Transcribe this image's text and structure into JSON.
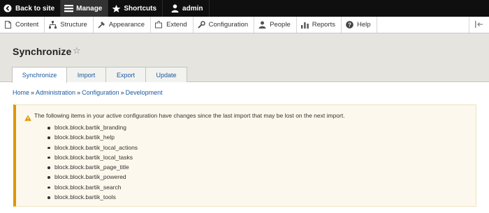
{
  "toolbar": {
    "back_label": "Back to site",
    "manage_label": "Manage",
    "shortcuts_label": "Shortcuts",
    "user_label": "admin"
  },
  "admin_menu": {
    "items": [
      {
        "label": "Content",
        "icon": "content-icon"
      },
      {
        "label": "Structure",
        "icon": "structure-icon"
      },
      {
        "label": "Appearance",
        "icon": "appearance-icon"
      },
      {
        "label": "Extend",
        "icon": "extend-icon"
      },
      {
        "label": "Configuration",
        "icon": "wrench-icon"
      },
      {
        "label": "People",
        "icon": "people-icon"
      },
      {
        "label": "Reports",
        "icon": "reports-icon"
      },
      {
        "label": "Help",
        "icon": "help-icon"
      }
    ]
  },
  "page": {
    "title": "Synchronize"
  },
  "tabs": [
    {
      "label": "Synchronize",
      "active": true
    },
    {
      "label": "Import",
      "active": false
    },
    {
      "label": "Export",
      "active": false
    },
    {
      "label": "Update",
      "active": false
    }
  ],
  "breadcrumb": {
    "items": [
      "Home",
      "Administration",
      "Configuration",
      "Development"
    ],
    "separator": "»"
  },
  "warning": {
    "message": "The following items in your active configuration have changes since the last import that may be lost on the next import.",
    "items": [
      "block.block.bartik_branding",
      "block.block.bartik_help",
      "block.block.bartik_local_actions",
      "block.block.bartik_local_tasks",
      "block.block.bartik_page_title",
      "block.block.bartik_powered",
      "block.block.bartik_search",
      "block.block.bartik_tools"
    ]
  },
  "colors": {
    "toolbar_bg": "#0f0f0f",
    "link": "#1a5aa0",
    "warning_accent": "#e09600",
    "warning_bg": "#fdf8ed"
  }
}
